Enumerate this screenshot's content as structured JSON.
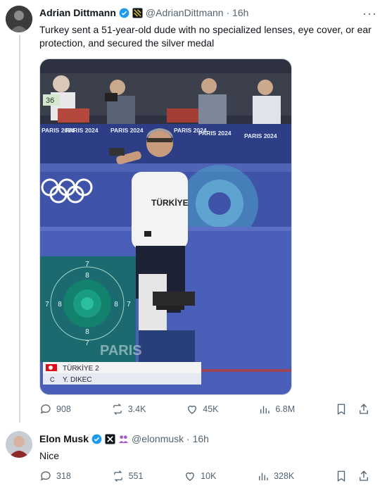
{
  "tweet1": {
    "name": "Adrian Dittmann",
    "handle_time": "@AdrianDittmann · 16h",
    "text": "Turkey sent a 51-year-old dude with no specialized lenses, eye cover, or ear protection, and secured the silver medal",
    "more": "···",
    "stats": {
      "replies": "908",
      "reposts": "3.4K",
      "likes": "45K",
      "views": "6.8M"
    },
    "media": {
      "lane_number": "36",
      "banner": "PARIS 2024",
      "shirt": "TÜRKİYE",
      "target_labels": [
        "7",
        "8",
        "7",
        "8",
        "8",
        "7",
        "8",
        "7"
      ],
      "watermark": "PARIS",
      "scoreboard_country": "TÜRKİYE 2",
      "scoreboard_letter": "C",
      "scoreboard_name": "Y. DIKEC"
    }
  },
  "tweet2": {
    "name": "Elon Musk",
    "handle_time": "@elonmusk · 16h",
    "text": "Nice",
    "stats": {
      "replies": "318",
      "reposts": "551",
      "likes": "10K",
      "views": "328K"
    }
  },
  "colors": {
    "verified": "#1d9bf0",
    "text_secondary": "#536471",
    "divider": "#cfd9de"
  }
}
